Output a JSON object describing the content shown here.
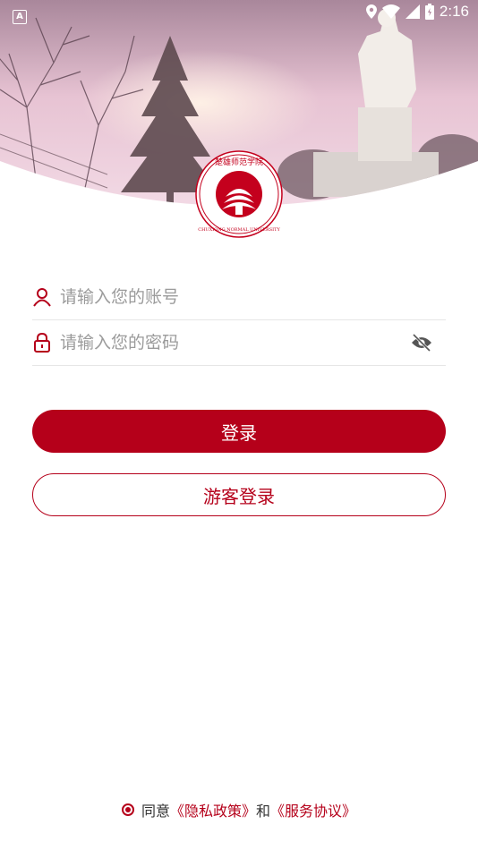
{
  "status_bar": {
    "left_badge": "A",
    "time": "2:16",
    "icons": [
      "location-icon",
      "wifi-icon",
      "signal-icon",
      "battery-icon"
    ]
  },
  "logo": {
    "name": "school-logo",
    "text_cn": "楚雄师范学院",
    "text_en": "CHUXIONG NORMAL UNIVERSITY"
  },
  "login_form": {
    "account_placeholder": "请输入您的账号",
    "password_placeholder": "请输入您的密码",
    "account_icon": "user-icon",
    "password_icon": "lock-icon",
    "toggle_icon": "eye-off-icon"
  },
  "buttons": {
    "login_label": "登录",
    "guest_login_label": "游客登录"
  },
  "agreement": {
    "agree_text": "同意",
    "privacy_link": "《隐私政策》",
    "and_text": "和",
    "service_link": "《服务协议》"
  },
  "colors": {
    "accent": "#b5001a",
    "placeholder": "#9b9b9b",
    "divider": "#e6e6e6"
  }
}
